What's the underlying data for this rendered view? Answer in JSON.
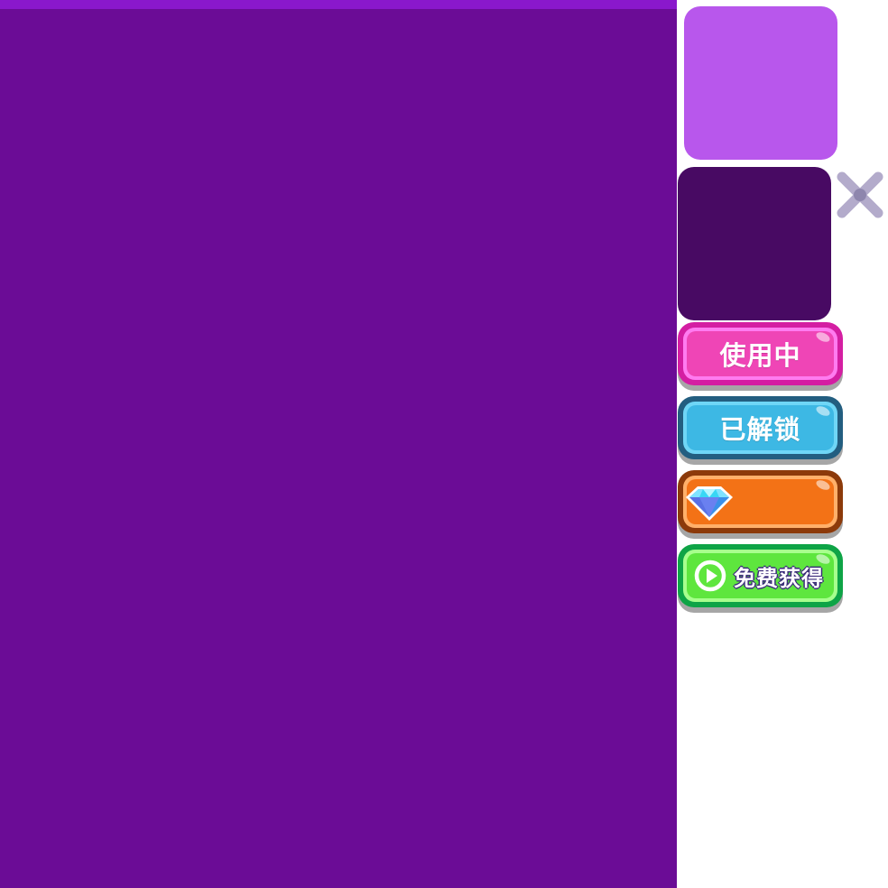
{
  "screen": {
    "main_panel_color": "#6b0c96",
    "main_panel_topbar_color": "#8a18cc"
  },
  "swatches": [
    {
      "name": "light-purple",
      "color": "#b857ec"
    },
    {
      "name": "dark-purple",
      "color": "#480a63"
    }
  ],
  "close": {
    "icon": "close-icon",
    "color": "#b3abcb"
  },
  "buttons": {
    "in_use": {
      "label": "使用中",
      "color": "#ef45b6"
    },
    "unlocked": {
      "label": "已解锁",
      "color": "#3db8e4"
    },
    "diamond": {
      "icon": "diamond-icon",
      "color": "#f37216"
    },
    "free": {
      "label": "免费获得",
      "icon": "play-circle-icon",
      "color": "#5ee63e"
    }
  }
}
